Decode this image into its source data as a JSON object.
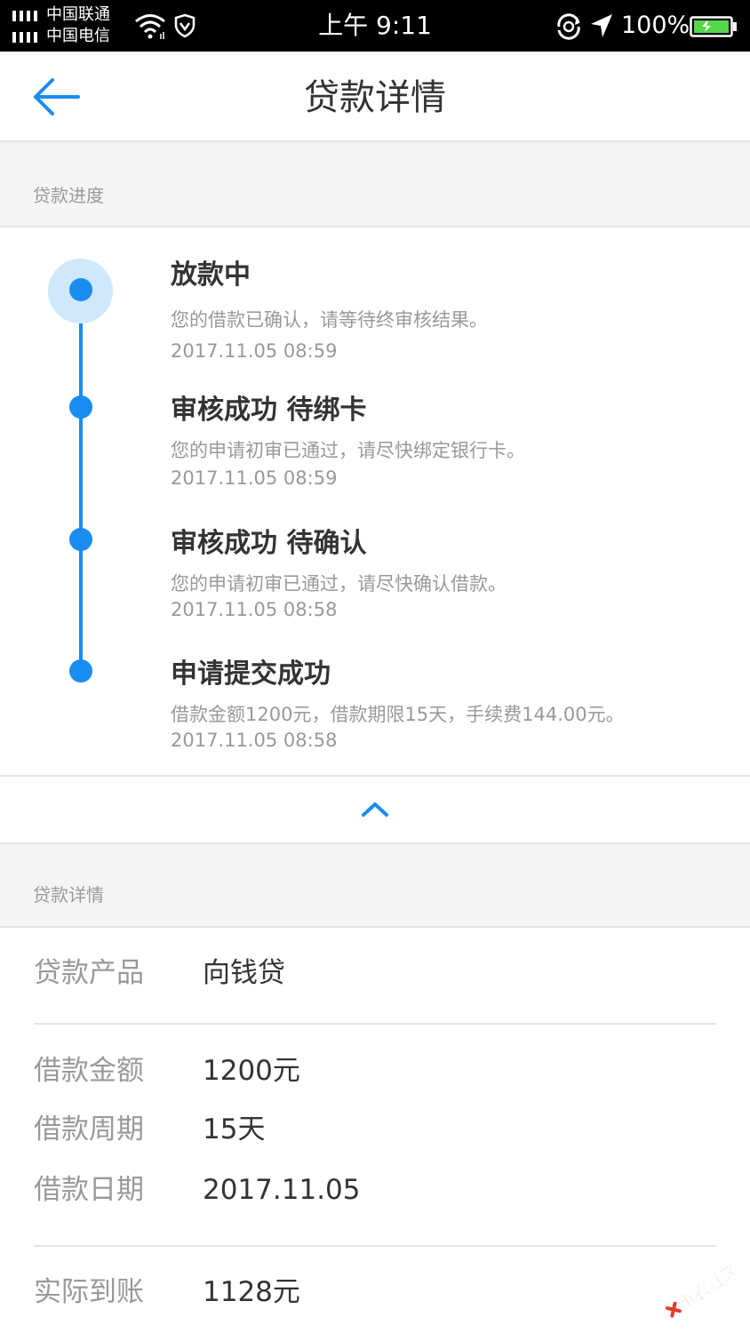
{
  "status_bar": {
    "carrier1": "中国联通",
    "carrier2": "中国电信",
    "time": "上午 9:11",
    "battery_pct": "100%",
    "battery_level": 1.0,
    "icons": [
      "signal-icon",
      "wifi-icon",
      "shield-icon",
      "rotation-lock-icon",
      "location-icon",
      "battery-icon"
    ]
  },
  "header": {
    "title": "贷款详情",
    "back_icon": "back-arrow-icon"
  },
  "progress_section": {
    "label": "贷款进度",
    "steps": [
      {
        "title": "放款中",
        "desc": "您的借款已确认，请等待终审核结果。",
        "time": "2017.11.05 08:59",
        "current": true
      },
      {
        "title": "审核成功 待绑卡",
        "desc": "您的申请初审已通过，请尽快绑定银行卡。",
        "time": "2017.11.05 08:59"
      },
      {
        "title": "审核成功 待确认",
        "desc": "您的申请初审已通过，请尽快确认借款。",
        "time": "2017.11.05 08:58"
      },
      {
        "title": "申请提交成功",
        "desc": "借款金额1200元，借款期限15天，手续费144.00元。",
        "time": "2017.11.05 08:58"
      }
    ],
    "collapse_icon": "chevron-up-icon"
  },
  "details_section": {
    "label": "贷款详情",
    "rows": [
      {
        "label": "贷款产品",
        "value": "向钱贷"
      },
      {
        "label": "借款金额",
        "value": "1200元"
      },
      {
        "label": "借款周期",
        "value": "15天"
      },
      {
        "label": "借款日期",
        "value": "2017.11.05"
      },
      {
        "label": "实际到账",
        "value": "1128元"
      }
    ]
  },
  "colors": {
    "accent": "#1a8cf0",
    "halo": "#cfe8fb",
    "section_bg": "#f5f5f5",
    "text_primary": "#333333",
    "text_secondary": "#999999"
  },
  "watermark": "卡农社区"
}
